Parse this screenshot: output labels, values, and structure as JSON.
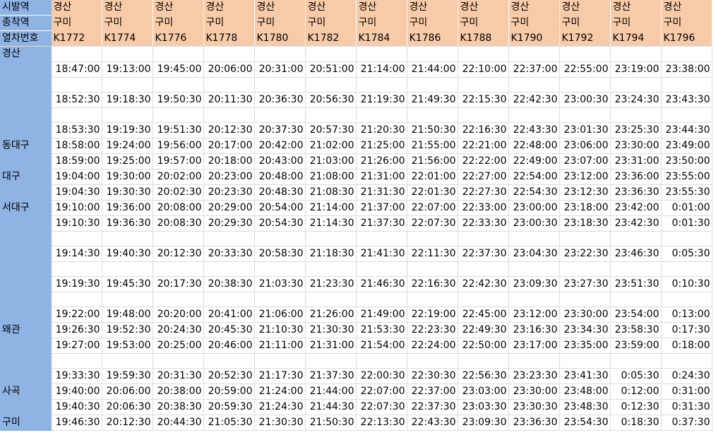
{
  "header": {
    "row_labels": [
      "시발역",
      "종착역",
      "열차번호"
    ],
    "origin": [
      "경산",
      "경산",
      "경산",
      "경산",
      "경산",
      "경산",
      "경산",
      "경산",
      "경산",
      "경산",
      "경산",
      "경산",
      "경산"
    ],
    "destination": [
      "구미",
      "구미",
      "구미",
      "구미",
      "구미",
      "구미",
      "구미",
      "구미",
      "구미",
      "구미",
      "구미",
      "구미",
      "구미"
    ],
    "train_numbers": [
      "K1772",
      "K1774",
      "K1776",
      "K1778",
      "K1780",
      "K1782",
      "K1784",
      "K1786",
      "K1788",
      "K1790",
      "K1792",
      "K1794",
      "K1796"
    ]
  },
  "rows": [
    {
      "station": "경산",
      "times": [
        "",
        "",
        "",
        "",
        "",
        "",
        "",
        "",
        "",
        "",
        "",
        "",
        ""
      ]
    },
    {
      "station": "",
      "times": [
        "18:47:00",
        "19:13:00",
        "19:45:00",
        "20:06:00",
        "20:31:00",
        "20:51:00",
        "21:14:00",
        "21:44:00",
        "22:10:00",
        "22:37:00",
        "22:55:00",
        "23:19:00",
        "23:38:00"
      ]
    },
    {
      "station": "",
      "times": [
        "",
        "",
        "",
        "",
        "",
        "",
        "",
        "",
        "",
        "",
        "",
        "",
        ""
      ]
    },
    {
      "station": "",
      "times": [
        "18:52:30",
        "19:18:30",
        "19:50:30",
        "20:11:30",
        "20:36:30",
        "20:56:30",
        "21:19:30",
        "21:49:30",
        "22:15:30",
        "22:42:30",
        "23:00:30",
        "23:24:30",
        "23:43:30"
      ]
    },
    {
      "station": "",
      "times": [
        "",
        "",
        "",
        "",
        "",
        "",
        "",
        "",
        "",
        "",
        "",
        "",
        ""
      ]
    },
    {
      "station": "",
      "times": [
        "18:53:30",
        "19:19:30",
        "19:51:30",
        "20:12:30",
        "20:37:30",
        "20:57:30",
        "21:20:30",
        "21:50:30",
        "22:16:30",
        "22:43:30",
        "23:01:30",
        "23:25:30",
        "23:44:30"
      ]
    },
    {
      "station": "동대구",
      "times": [
        "18:58:00",
        "19:24:00",
        "19:56:00",
        "20:17:00",
        "20:42:00",
        "21:02:00",
        "21:25:00",
        "21:55:00",
        "22:21:00",
        "22:48:00",
        "23:06:00",
        "23:30:00",
        "23:49:00"
      ]
    },
    {
      "station": "",
      "times": [
        "18:59:00",
        "19:25:00",
        "19:57:00",
        "20:18:00",
        "20:43:00",
        "21:03:00",
        "21:26:00",
        "21:56:00",
        "22:22:00",
        "22:49:00",
        "23:07:00",
        "23:31:00",
        "23:50:00"
      ]
    },
    {
      "station": "대구",
      "times": [
        "19:04:00",
        "19:30:00",
        "20:02:00",
        "20:23:00",
        "20:48:00",
        "21:08:00",
        "21:31:00",
        "22:01:00",
        "22:27:00",
        "22:54:00",
        "23:12:00",
        "23:36:00",
        "23:55:00"
      ]
    },
    {
      "station": "",
      "times": [
        "19:04:30",
        "19:30:30",
        "20:02:30",
        "20:23:30",
        "20:48:30",
        "21:08:30",
        "21:31:30",
        "22:01:30",
        "22:27:30",
        "22:54:30",
        "23:12:30",
        "23:36:30",
        "23:55:30"
      ]
    },
    {
      "station": "서대구",
      "times": [
        "19:10:00",
        "19:36:00",
        "20:08:00",
        "20:29:00",
        "20:54:00",
        "21:14:00",
        "21:37:00",
        "22:07:00",
        "22:33:00",
        "23:00:00",
        "23:18:00",
        "23:42:00",
        "0:01:00"
      ]
    },
    {
      "station": "",
      "times": [
        "19:10:30",
        "19:36:30",
        "20:08:30",
        "20:29:30",
        "20:54:30",
        "21:14:30",
        "21:37:30",
        "22:07:30",
        "22:33:30",
        "23:00:30",
        "23:18:30",
        "23:42:30",
        "0:01:30"
      ]
    },
    {
      "station": "",
      "times": [
        "",
        "",
        "",
        "",
        "",
        "",
        "",
        "",
        "",
        "",
        "",
        "",
        ""
      ]
    },
    {
      "station": "",
      "times": [
        "19:14:30",
        "19:40:30",
        "20:12:30",
        "20:33:30",
        "20:58:30",
        "21:18:30",
        "21:41:30",
        "22:11:30",
        "22:37:30",
        "23:04:30",
        "23:22:30",
        "23:46:30",
        "0:05:30"
      ]
    },
    {
      "station": "",
      "times": [
        "",
        "",
        "",
        "",
        "",
        "",
        "",
        "",
        "",
        "",
        "",
        "",
        ""
      ]
    },
    {
      "station": "",
      "times": [
        "19:19:30",
        "19:45:30",
        "20:17:30",
        "20:38:30",
        "21:03:30",
        "21:23:30",
        "21:46:30",
        "22:16:30",
        "22:42:30",
        "23:09:30",
        "23:27:30",
        "23:51:30",
        "0:10:30"
      ]
    },
    {
      "station": "",
      "times": [
        "",
        "",
        "",
        "",
        "",
        "",
        "",
        "",
        "",
        "",
        "",
        "",
        ""
      ]
    },
    {
      "station": "",
      "times": [
        "19:22:00",
        "19:48:00",
        "20:20:00",
        "20:41:00",
        "21:06:00",
        "21:26:00",
        "21:49:00",
        "22:19:00",
        "22:45:00",
        "23:12:00",
        "23:30:00",
        "23:54:00",
        "0:13:00"
      ]
    },
    {
      "station": "왜관",
      "times": [
        "19:26:30",
        "19:52:30",
        "20:24:30",
        "20:45:30",
        "21:10:30",
        "21:30:30",
        "21:53:30",
        "22:23:30",
        "22:49:30",
        "23:16:30",
        "23:34:30",
        "23:58:30",
        "0:17:30"
      ]
    },
    {
      "station": "",
      "times": [
        "19:27:00",
        "19:53:00",
        "20:25:00",
        "20:46:00",
        "21:11:00",
        "21:31:00",
        "21:54:00",
        "22:24:00",
        "22:50:00",
        "23:17:00",
        "23:35:00",
        "23:59:00",
        "0:18:00"
      ]
    },
    {
      "station": "",
      "times": [
        "",
        "",
        "",
        "",
        "",
        "",
        "",
        "",
        "",
        "",
        "",
        "",
        ""
      ]
    },
    {
      "station": "",
      "times": [
        "19:33:30",
        "19:59:30",
        "20:31:30",
        "20:52:30",
        "21:17:30",
        "21:37:30",
        "22:00:30",
        "22:30:30",
        "22:56:30",
        "23:23:30",
        "23:41:30",
        "0:05:30",
        "0:24:30"
      ]
    },
    {
      "station": "사곡",
      "times": [
        "19:40:00",
        "20:06:00",
        "20:38:00",
        "20:59:00",
        "21:24:00",
        "21:44:00",
        "22:07:00",
        "22:37:00",
        "23:03:00",
        "23:30:00",
        "23:48:00",
        "0:12:00",
        "0:31:00"
      ]
    },
    {
      "station": "",
      "times": [
        "19:40:30",
        "20:06:30",
        "20:38:30",
        "20:59:30",
        "21:24:30",
        "21:44:30",
        "22:07:30",
        "22:37:30",
        "23:03:30",
        "23:30:30",
        "23:48:30",
        "0:12:30",
        "0:31:30"
      ]
    },
    {
      "station": "구미",
      "times": [
        "19:46:30",
        "20:12:30",
        "20:44:30",
        "21:05:30",
        "21:30:30",
        "21:50:30",
        "22:13:30",
        "22:43:30",
        "23:09:30",
        "23:36:30",
        "23:54:30",
        "0:18:30",
        "0:37:30"
      ]
    }
  ],
  "colors": {
    "header_bg": "#f8cba8",
    "label_bg": "#8eb4e3",
    "grid": "#dcdcdc"
  }
}
